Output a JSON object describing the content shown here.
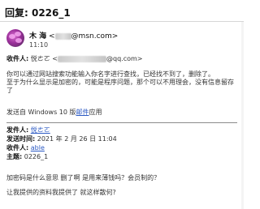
{
  "subject": "回复: 0226_1",
  "sender": {
    "name": "木 海",
    "email_suffix": "@msn.com>",
    "time": "11:10"
  },
  "recipients": {
    "label": "收件人:",
    "name": "悦ㄜㄛ",
    "email_suffix": "@qq.com>"
  },
  "body": {
    "line1": "你可以通过网站搜索功能输入你名字进行查找，已经找不到了，删除了。",
    "line2": "至于为什么显示是加密的，可能是程序问题，那个可以不用理会，没有信息留存了",
    "signature_prefix": "发送自 Windows 10 版",
    "signature_link": "邮件",
    "signature_suffix": "应用"
  },
  "quoted": {
    "from_label": "发件人:",
    "from_value": "悦ㄜㄛ",
    "sent_label": "发送时间:",
    "sent_value": "2021 年 2 月 26 日 11:04",
    "to_label": "收件人:",
    "to_value": "able",
    "subject_label": "主题:",
    "subject_value": "0226_1"
  },
  "tail": {
    "line1": "加密码是什么意思 删了啊  是用来薄钱吗？会员制的？",
    "line2": "让我提供的资料我提供了 就这样散何?"
  }
}
